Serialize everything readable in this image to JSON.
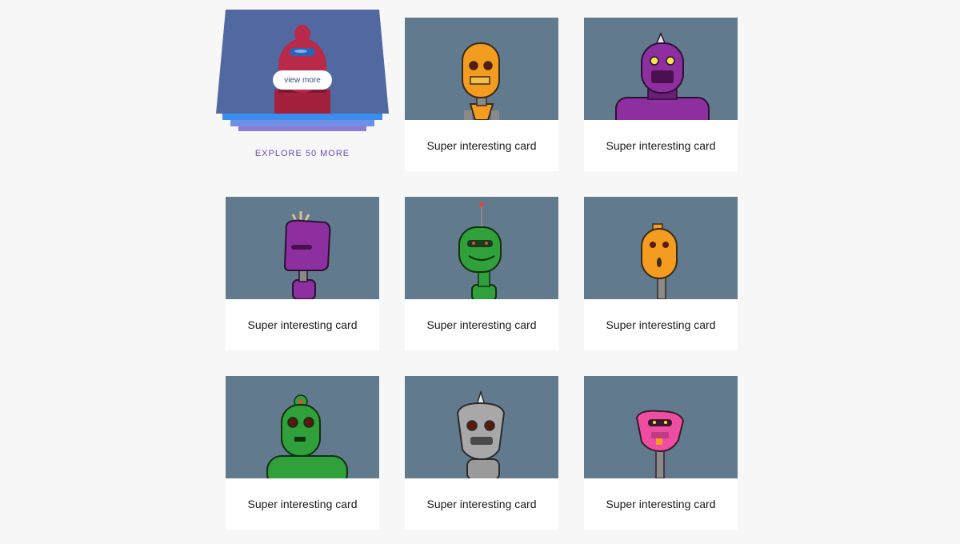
{
  "featured": {
    "button_label": "view more",
    "explore_link": "EXPLORE 50 MORE"
  },
  "cards": [
    {
      "caption": "Super interesting card",
      "robot": "orange-robot"
    },
    {
      "caption": "Super interesting card",
      "robot": "purple-robot"
    },
    {
      "caption": "Super interesting card",
      "robot": "violet-robot"
    },
    {
      "caption": "Super interesting card",
      "robot": "green-robot"
    },
    {
      "caption": "Super interesting card",
      "robot": "orange-robot"
    },
    {
      "caption": "Super interesting card",
      "robot": "green-robot"
    },
    {
      "caption": "Super interesting card",
      "robot": "gray-robot"
    },
    {
      "caption": "Super interesting card",
      "robot": "pink-robot"
    }
  ],
  "colors": {
    "page_bg": "#f7f7f7",
    "thumb_bg": "#617a8d",
    "featured_bg": "#5168a0",
    "accent": "#6b4fb3"
  }
}
